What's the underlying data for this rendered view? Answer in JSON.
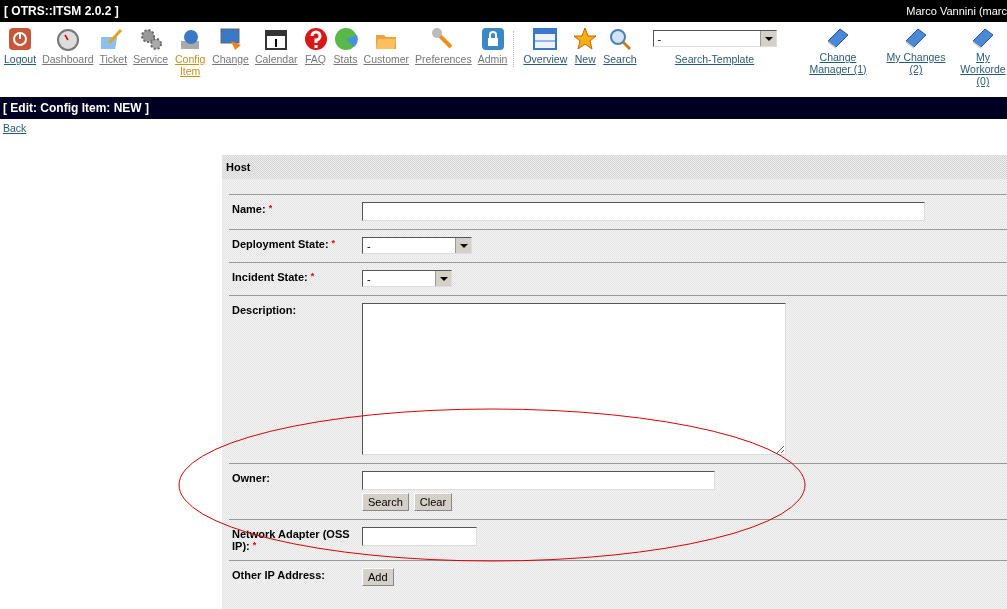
{
  "header": {
    "title": "[ OTRS::ITSM 2.0.2 ]",
    "user": "Marco Vannini (marc"
  },
  "nav": [
    {
      "label": "Logout",
      "selected": false
    },
    {
      "label": "Dashboard",
      "selected": false
    },
    {
      "label": "Ticket",
      "selected": false
    },
    {
      "label": "Service",
      "selected": false
    },
    {
      "label": "Config Item",
      "selected": true
    },
    {
      "label": "Change",
      "selected": false
    },
    {
      "label": "Calendar",
      "selected": false
    },
    {
      "label": "FAQ",
      "selected": false
    },
    {
      "label": "Stats",
      "selected": false
    },
    {
      "label": "Customer",
      "selected": false
    },
    {
      "label": "Preferences",
      "selected": false
    },
    {
      "label": "Admin",
      "selected": false
    }
  ],
  "subnav": [
    {
      "label": "Overview"
    },
    {
      "label": "New"
    },
    {
      "label": "Search"
    }
  ],
  "search_template": {
    "value": "-",
    "label": "Search-Template"
  },
  "change_links": [
    {
      "label": "Change Manager (1)"
    },
    {
      "label": "My Changes (2)"
    },
    {
      "label": "My Workorde (0)"
    }
  ],
  "page_title": "[ Edit: Config Item: NEW ]",
  "back_link": "Back",
  "section": "Host",
  "required_marker": "*",
  "fields": [
    {
      "kind": "text",
      "label": "Name:",
      "required": true
    },
    {
      "kind": "select",
      "label": "Deployment State:",
      "required": true,
      "value": "-"
    },
    {
      "kind": "select",
      "label": "Incident State:",
      "required": true,
      "value": "-"
    },
    {
      "kind": "textarea",
      "label": "Description:",
      "required": false
    },
    {
      "kind": "owner",
      "label": "Owner:",
      "required": false,
      "buttons": [
        "Search",
        "Clear"
      ]
    },
    {
      "kind": "text",
      "label": "Network Adapter (OSS IP):",
      "required": true
    },
    {
      "kind": "add",
      "label": "Other IP Address:",
      "required": false,
      "buttons": [
        "Add"
      ]
    }
  ]
}
